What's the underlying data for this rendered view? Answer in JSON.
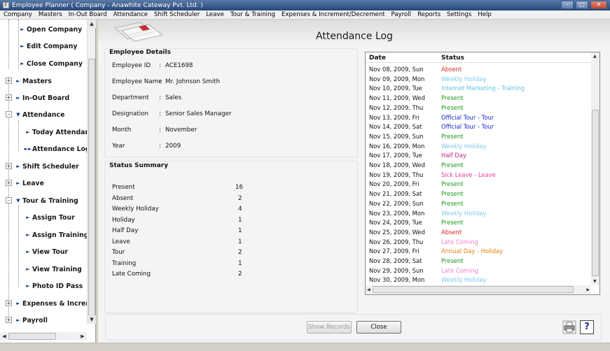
{
  "window": {
    "title": "Employee Planner ( Company - Anawhite Cateway Pvt. Ltd. )"
  },
  "menu": [
    "Company",
    "Masters",
    "In-Out Board",
    "Attendance",
    "Shift Scheduler",
    "Leave",
    "Tour & Training",
    "Expenses & Increment/Decrement",
    "Payroll",
    "Reports",
    "Settings",
    "Help"
  ],
  "sidebar": {
    "items": [
      {
        "label": "Open Company",
        "level": 2
      },
      {
        "label": "Edit Company",
        "level": 2
      },
      {
        "label": "Close Company",
        "level": 2
      },
      {
        "label": "Masters",
        "level": 1,
        "expanded": false
      },
      {
        "label": "In-Out Board",
        "level": 1,
        "expanded": false
      },
      {
        "label": "Attendance",
        "level": 1,
        "expanded": true
      },
      {
        "label": "Today Attendance",
        "level": 2
      },
      {
        "label": "Attendance Log",
        "level": 2,
        "selected": true
      },
      {
        "label": "Shift Scheduler",
        "level": 1,
        "expanded": false
      },
      {
        "label": "Leave",
        "level": 1,
        "expanded": false
      },
      {
        "label": "Tour & Training",
        "level": 1,
        "expanded": true
      },
      {
        "label": "Assign Tour",
        "level": 2
      },
      {
        "label": "Assign Training",
        "level": 2
      },
      {
        "label": "View Tour",
        "level": 2
      },
      {
        "label": "View Training",
        "level": 2
      },
      {
        "label": "Photo ID Pass",
        "level": 2
      },
      {
        "label": "Expenses & Increment/Decrement",
        "level": 1,
        "expanded": false
      },
      {
        "label": "Payroll",
        "level": 1,
        "expanded": false
      }
    ]
  },
  "page": {
    "title": "Attendance Log"
  },
  "employee_details": {
    "heading": "Employee Details",
    "fields": [
      {
        "label": "Employee ID",
        "value": "ACE1698"
      },
      {
        "label": "Employee Name",
        "value": "Mr. Johnson Smith"
      },
      {
        "label": "Department",
        "value": "Sales"
      },
      {
        "label": "Designation",
        "value": "Senior Sales Manager"
      },
      {
        "label": "Month",
        "value": "November"
      },
      {
        "label": "Year",
        "value": "2009"
      }
    ],
    "separator": ":"
  },
  "status_summary": {
    "heading": "Status Summary",
    "rows": [
      {
        "label": "Present",
        "count": "16"
      },
      {
        "label": "Absent",
        "count": "2"
      },
      {
        "label": "Weekly Holiday",
        "count": "4"
      },
      {
        "label": "Holiday",
        "count": "1"
      },
      {
        "label": "Half Day",
        "count": "1"
      },
      {
        "label": "Leave",
        "count": "1"
      },
      {
        "label": "Tour",
        "count": "2"
      },
      {
        "label": "Training",
        "count": "1"
      },
      {
        "label": "Late Coming",
        "count": "2"
      }
    ]
  },
  "log_table": {
    "columns": [
      "Date",
      "Status"
    ],
    "rows": [
      {
        "date": "Nov 08, 2009,  Sun",
        "status": "Absent",
        "color": "#e02020"
      },
      {
        "date": "Nov 09, 2009,  Mon",
        "status": "Weekly Holiday",
        "color": "#7ec8e8"
      },
      {
        "date": "Nov 10, 2009,  Tue",
        "status": "Internet Marketing - Training",
        "color": "#5fc4e0"
      },
      {
        "date": "Nov 11, 2009,  Wed",
        "status": "Present",
        "color": "#1a9a1a"
      },
      {
        "date": "Nov 12, 2009,  Thu",
        "status": "Present",
        "color": "#1a9a1a"
      },
      {
        "date": "Nov 13, 2009,  Fri",
        "status": "Official Tour - Tour",
        "color": "#1a2ad0"
      },
      {
        "date": "Nov 14, 2009,  Sat",
        "status": "Official Tour - Tour",
        "color": "#1a2ad0"
      },
      {
        "date": "Nov 15, 2009,  Sun",
        "status": "Present",
        "color": "#1a9a1a"
      },
      {
        "date": "Nov 16, 2009,  Mon",
        "status": "Weekly Holiday",
        "color": "#7ec8e8"
      },
      {
        "date": "Nov 17, 2009,  Tue",
        "status": "Half Day",
        "color": "#c02080"
      },
      {
        "date": "Nov 18, 2009,  Wed",
        "status": "Present",
        "color": "#1a9a1a"
      },
      {
        "date": "Nov 19, 2009,  Thu",
        "status": "Sick Leave - Leave",
        "color": "#e040a0"
      },
      {
        "date": "Nov 20, 2009,  Fri",
        "status": "Present",
        "color": "#1a9a1a"
      },
      {
        "date": "Nov 21, 2009,  Sat",
        "status": "Present",
        "color": "#1a9a1a"
      },
      {
        "date": "Nov 22, 2009,  Sun",
        "status": "Present",
        "color": "#1a9a1a"
      },
      {
        "date": "Nov 23, 2009,  Mon",
        "status": "Weekly Holiday",
        "color": "#7ec8e8"
      },
      {
        "date": "Nov 24, 2009,  Tue",
        "status": "Present",
        "color": "#1a9a1a"
      },
      {
        "date": "Nov 25, 2009,  Wed",
        "status": "Absent",
        "color": "#e02020"
      },
      {
        "date": "Nov 26, 2009,  Thu",
        "status": "Late Coming",
        "color": "#f080d0"
      },
      {
        "date": "Nov 27, 2009,  Fri",
        "status": "Annual Day - Holiday",
        "color": "#e08010"
      },
      {
        "date": "Nov 28, 2009,  Sat",
        "status": "Present",
        "color": "#1a9a1a"
      },
      {
        "date": "Nov 29, 2009,  Sun",
        "status": "Late Coming",
        "color": "#f080d0"
      },
      {
        "date": "Nov 30, 2009,  Mon",
        "status": "Weekly Holiday",
        "color": "#7ec8e8"
      }
    ]
  },
  "buttons": {
    "show_records": "Show Records",
    "close": "Close"
  },
  "icons": {
    "print": "printer-icon",
    "help": "help-icon",
    "help_glyph": "?"
  }
}
